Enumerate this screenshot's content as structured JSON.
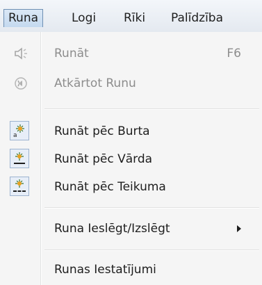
{
  "menubar": {
    "items": [
      {
        "label": "Runa"
      },
      {
        "label": "Logi"
      },
      {
        "label": "Rīki"
      },
      {
        "label": "Palīdzība"
      }
    ]
  },
  "menu": {
    "items": [
      {
        "label": "Runāt",
        "shortcut": "F6",
        "icon": "speaker-icon",
        "enabled": false
      },
      {
        "label": "Atkārtot Runu",
        "icon": "repeat-icon",
        "enabled": false
      },
      {
        "label": "Runāt pēc Burta",
        "icon": "speak-letter-icon",
        "enabled": true
      },
      {
        "label": "Runāt pēc Vārda",
        "icon": "speak-word-icon",
        "enabled": true
      },
      {
        "label": "Runāt pēc Teikuma",
        "icon": "speak-sentence-icon",
        "enabled": true
      },
      {
        "label": "Runa Ieslēgt/Izslēgt",
        "submenu": true,
        "enabled": true
      },
      {
        "label": "Runas Iestatījumi",
        "enabled": true
      }
    ]
  },
  "colors": {
    "accent": "#c4d9ef",
    "disabled_text": "#8d8d8d"
  }
}
